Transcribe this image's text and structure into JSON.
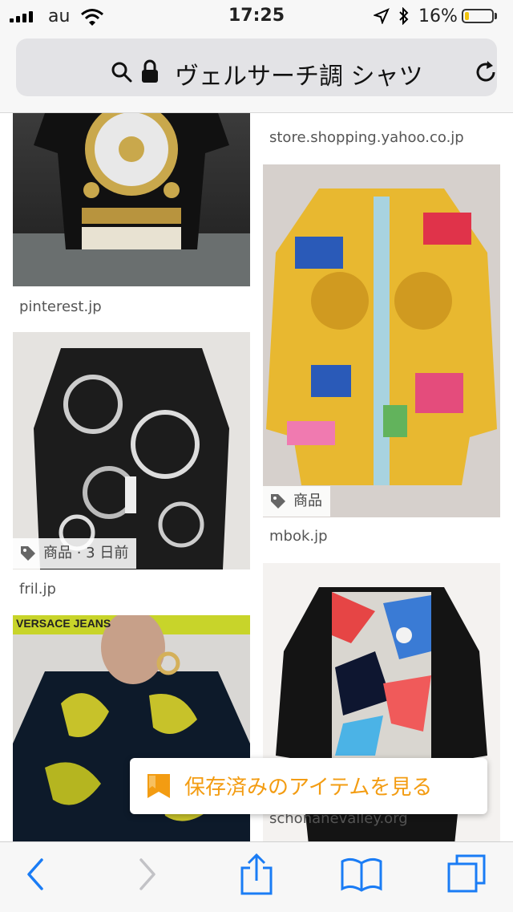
{
  "status": {
    "carrier": "au",
    "time": "17:25",
    "battery_pct": "16%",
    "battery_level": 0.16,
    "battery_color": "#f1c40f"
  },
  "address": {
    "title": "ヴェルサーチ調 シャツ"
  },
  "results": {
    "col1": [
      {
        "source": "pinterest.jp",
        "image": "shirt-image"
      },
      {
        "source": "fril.jp",
        "tag": "商品 · 3 日前",
        "image": "shirt-image"
      },
      {
        "source": "",
        "image": "shirt-image",
        "logo_text": "VERSACE JEANS"
      }
    ],
    "col2": [
      {
        "source": "store.shopping.yahoo.co.jp"
      },
      {
        "source": "mbok.jp",
        "tag": "商品",
        "image": "shirt-image"
      },
      {
        "source": "schonanevalley.org",
        "image": "shirt-image"
      }
    ]
  },
  "toast": {
    "label": "保存済みのアイテムを見る",
    "color": "#f39c12"
  },
  "toolbar": {
    "accent": "#1a7cf5",
    "icons": [
      "back-icon",
      "forward-icon",
      "share-icon",
      "bookmarks-icon",
      "tabs-icon"
    ]
  }
}
